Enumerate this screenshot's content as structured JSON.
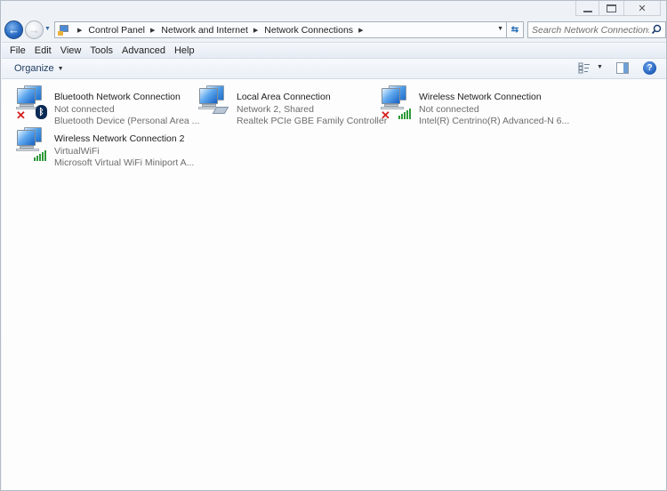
{
  "window": {
    "caption_buttons": [
      "minimize",
      "maximize",
      "close"
    ]
  },
  "nav": {
    "back_icon": "back-arrow-icon",
    "forward_icon": "forward-arrow-icon",
    "breadcrumb": [
      "Control Panel",
      "Network and Internet",
      "Network Connections"
    ],
    "refresh_icon": "refresh-icon",
    "search_placeholder": "Search Network Connections",
    "search_value": ""
  },
  "menu": {
    "items": [
      "File",
      "Edit",
      "View",
      "Tools",
      "Advanced",
      "Help"
    ]
  },
  "commandbar": {
    "organize_label": "Organize",
    "views_icon": "change-view-icon",
    "preview_icon": "preview-pane-icon",
    "help_icon": "help-icon"
  },
  "connections": [
    {
      "name": "Bluetooth Network Connection",
      "status": "Not connected",
      "device": "Bluetooth Device (Personal Area ...",
      "badge": "bluetooth",
      "disconnected": true
    },
    {
      "name": "Local Area Connection",
      "status": "Network  2, Shared",
      "device": "Realtek PCIe GBE Family Controller",
      "badge": "ethernet",
      "disconnected": false
    },
    {
      "name": "Wireless Network Connection",
      "status": "Not connected",
      "device": "Intel(R) Centrino(R) Advanced-N 6...",
      "badge": "signal-bars",
      "disconnected": true
    },
    {
      "name": "Wireless Network Connection 2",
      "status": "VirtualWiFi",
      "device": "Microsoft Virtual WiFi Miniport A...",
      "badge": "signal-bars",
      "disconnected": false
    }
  ]
}
